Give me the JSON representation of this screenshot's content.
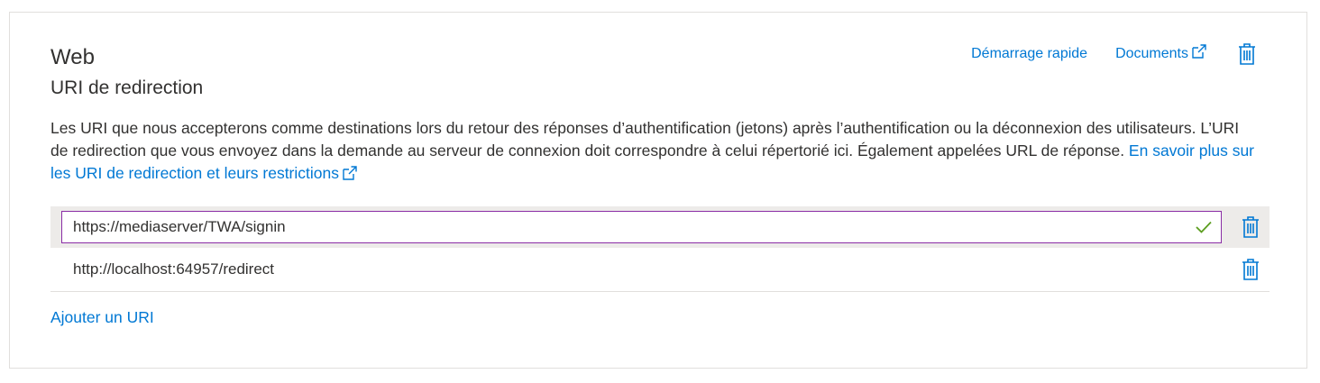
{
  "section": {
    "title": "Web",
    "subtitle": "URI de redirection",
    "quickstart_label": "Démarrage rapide",
    "docs_label": "Documents",
    "description_text": "Les URI que nous accepterons comme destinations lors du retour des réponses d’authentification (jetons) après l’authentification ou la déconnexion des utilisateurs. L’URI de redirection que vous envoyez dans la demande au serveur de connexion doit correspondre à celui répertorié ici. Également appelées URL de réponse. ",
    "learn_more_label": "En savoir plus sur les URI de redirection et leurs restrictions"
  },
  "redirect_uris": [
    {
      "value": "https://mediaserver/TWA/signin",
      "editing": true,
      "valid": true
    },
    {
      "value": "http://localhost:64957/redirect",
      "editing": false
    }
  ],
  "add_uri_label": "Ajouter un URI",
  "icons": {
    "external": "external-link-icon",
    "delete": "trash-icon",
    "valid": "checkmark-icon"
  },
  "colors": {
    "link": "#0078d4",
    "active_border": "#8a2da5",
    "valid_check": "#5b9d1e",
    "row_highlight": "#edebe9"
  }
}
